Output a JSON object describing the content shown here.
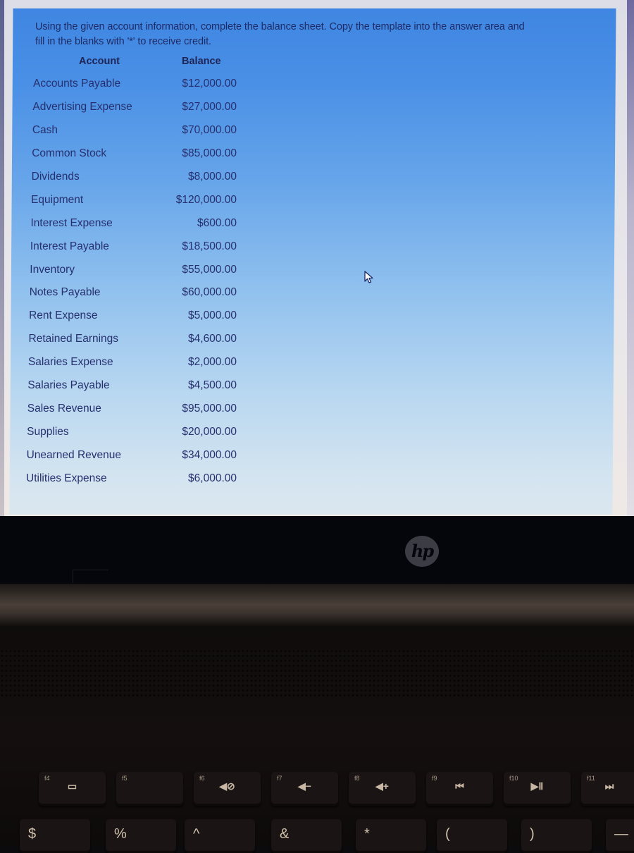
{
  "prompt": {
    "line1": "Using the given account information, complete the balance sheet. Copy the template into the answer area and",
    "line2": "fill in the blanks with '*' to receive credit."
  },
  "table": {
    "headers": {
      "account": "Account",
      "balance": "Balance"
    },
    "rows": [
      {
        "account": "Accounts Payable",
        "balance": "$12,000.00"
      },
      {
        "account": "Advertising Expense",
        "balance": "$27,000.00"
      },
      {
        "account": "Cash",
        "balance": "$70,000.00"
      },
      {
        "account": "Common Stock",
        "balance": "$85,000.00"
      },
      {
        "account": "Dividends",
        "balance": "$8,000.00"
      },
      {
        "account": "Equipment",
        "balance": "$120,000.00"
      },
      {
        "account": "Interest Expense",
        "balance": "$600.00"
      },
      {
        "account": "Interest Payable",
        "balance": "$18,500.00"
      },
      {
        "account": "Inventory",
        "balance": "$55,000.00"
      },
      {
        "account": "Notes Payable",
        "balance": "$60,000.00"
      },
      {
        "account": "Rent Expense",
        "balance": "$5,000.00"
      },
      {
        "account": "Retained Earnings",
        "balance": "$4,600.00"
      },
      {
        "account": "Salaries Expense",
        "balance": "$2,000.00"
      },
      {
        "account": "Salaries Payable",
        "balance": "$4,500.00"
      },
      {
        "account": "Sales Revenue",
        "balance": "$95,000.00"
      },
      {
        "account": "Supplies",
        "balance": "$20,000.00"
      },
      {
        "account": "Unearned Revenue",
        "balance": "$34,000.00"
      },
      {
        "account": "Utilities Expense",
        "balance": "$6,000.00"
      }
    ]
  },
  "laptop": {
    "brand_logo": "hp",
    "fn_keys": [
      {
        "label": "f4",
        "icon": "display-switch-icon",
        "glyph": "▭"
      },
      {
        "label": "f5",
        "icon": "none",
        "glyph": ""
      },
      {
        "label": "f6",
        "icon": "mute-icon",
        "glyph": "◀⊘"
      },
      {
        "label": "f7",
        "icon": "volume-down-icon",
        "glyph": "◀−"
      },
      {
        "label": "f8",
        "icon": "volume-up-icon",
        "glyph": "◀+"
      },
      {
        "label": "f9",
        "icon": "previous-track-icon",
        "glyph": "⏮"
      },
      {
        "label": "f10",
        "icon": "play-pause-icon",
        "glyph": "▶Ⅱ"
      },
      {
        "label": "f11",
        "icon": "next-track-icon",
        "glyph": "⏭"
      }
    ],
    "number_keys": [
      {
        "glyph": "$"
      },
      {
        "glyph": "%"
      },
      {
        "glyph": "^"
      },
      {
        "glyph": "&"
      },
      {
        "glyph": "*"
      },
      {
        "glyph": "("
      },
      {
        "glyph": ")"
      },
      {
        "glyph": "—"
      }
    ]
  }
}
